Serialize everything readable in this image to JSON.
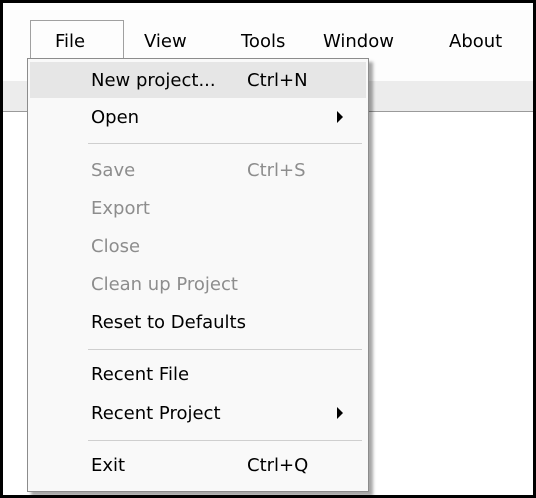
{
  "menubar": {
    "items": [
      {
        "label": "File"
      },
      {
        "label": "View"
      },
      {
        "label": "Tools"
      },
      {
        "label": "Window"
      },
      {
        "label": "About"
      }
    ]
  },
  "file_menu": {
    "items": [
      {
        "label": "New project...",
        "shortcut": "Ctrl+N",
        "enabled": true,
        "highlighted": true
      },
      {
        "label": "Open",
        "shortcut": "",
        "enabled": true,
        "submenu": true
      },
      {
        "label": "Save",
        "shortcut": "Ctrl+S",
        "enabled": false
      },
      {
        "label": "Export",
        "shortcut": "",
        "enabled": false
      },
      {
        "label": "Close",
        "shortcut": "",
        "enabled": false
      },
      {
        "label": "Clean up Project",
        "shortcut": "",
        "enabled": false
      },
      {
        "label": "Reset to Defaults",
        "shortcut": "",
        "enabled": true
      },
      {
        "label": "Recent File",
        "shortcut": "",
        "enabled": true
      },
      {
        "label": "Recent Project",
        "shortcut": "",
        "enabled": true,
        "submenu": true
      },
      {
        "label": "Exit",
        "shortcut": "Ctrl+Q",
        "enabled": true
      }
    ]
  }
}
